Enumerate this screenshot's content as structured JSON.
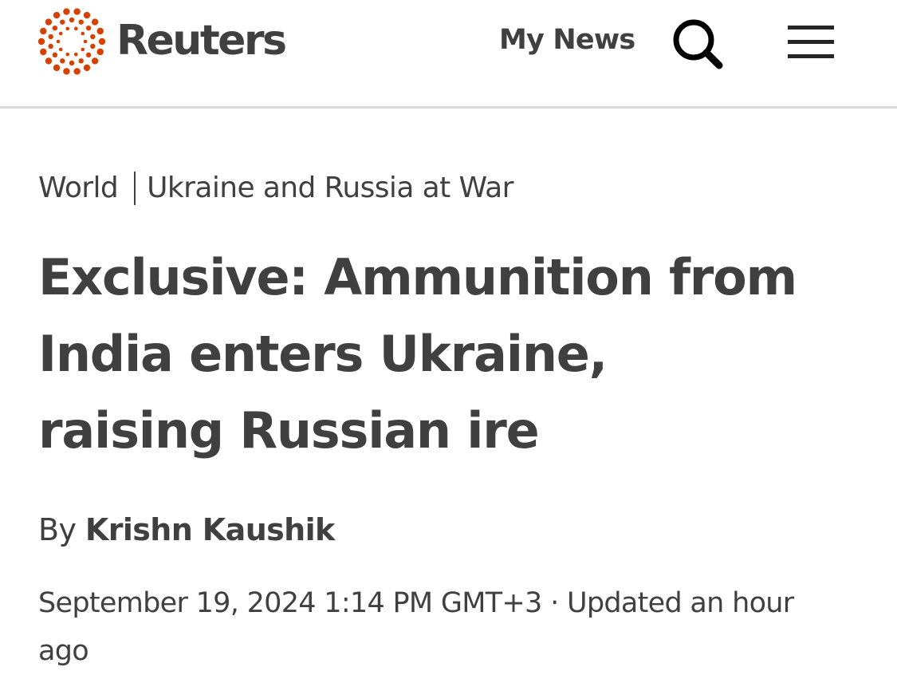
{
  "header": {
    "logo_text": "Reuters",
    "my_news_label": "My News",
    "icons": {
      "logo": "reuters-dots-logo",
      "search": "search-icon",
      "menu": "hamburger-menu-icon"
    },
    "colors": {
      "brand_orange": "#d64000",
      "text": "#404040",
      "divider": "#d9d9d9"
    }
  },
  "breadcrumb": {
    "section": "World",
    "topic": "Ukraine and Russia at War"
  },
  "article": {
    "headline": "Exclusive: Ammunition from India enters Ukraine, raising Russian ire",
    "byline_prefix": "By",
    "author": "Krishn Kaushik",
    "published": "September 19, 2024 1:14 PM GMT+3",
    "separator": "·",
    "updated": "Updated an hour ago"
  }
}
